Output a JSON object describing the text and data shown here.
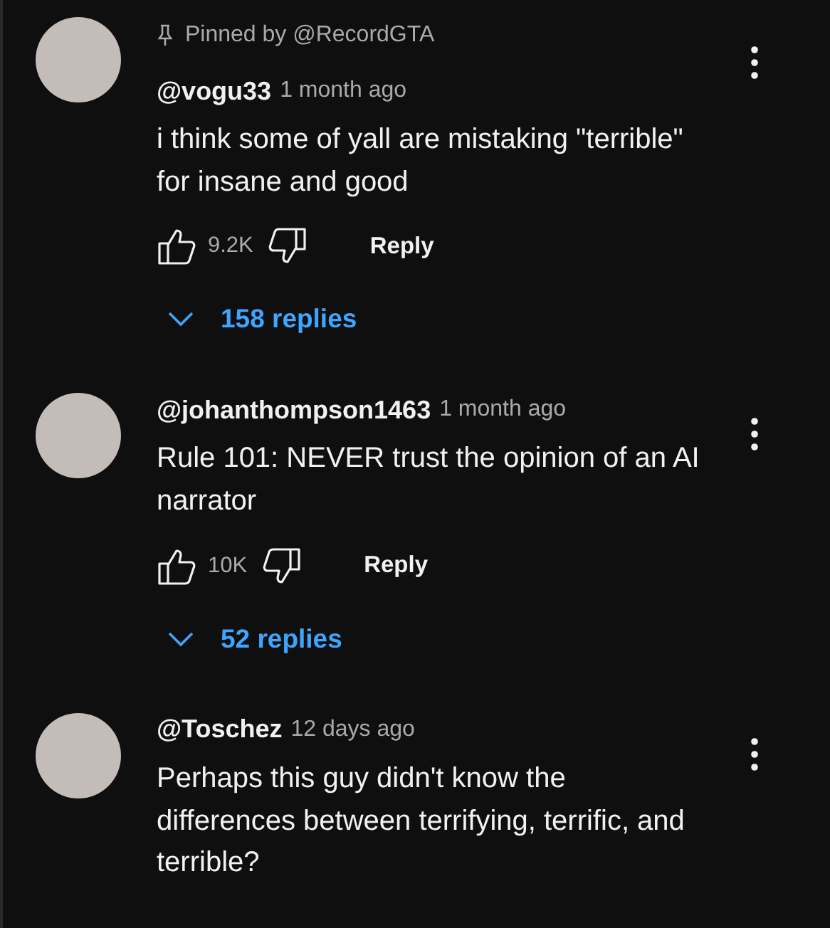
{
  "comments": [
    {
      "pinned_by": "Pinned by @RecordGTA",
      "author": "@vogu33",
      "time": "1 month ago",
      "text": "i think some of yall are mistaking \"terrible\" for insane and good",
      "likes": "9.2K",
      "reply_label": "Reply",
      "replies": "158 replies"
    },
    {
      "author": "@johanthompson1463",
      "time": "1 month ago",
      "text": "Rule 101: NEVER trust the opinion of an AI narrator",
      "likes": "10K",
      "reply_label": "Reply",
      "replies": "52 replies"
    },
    {
      "author": "@Toschez",
      "time": "12 days ago",
      "text": "Perhaps this guy didn't know the differences between terrifying, terrific, and terrible?"
    }
  ]
}
